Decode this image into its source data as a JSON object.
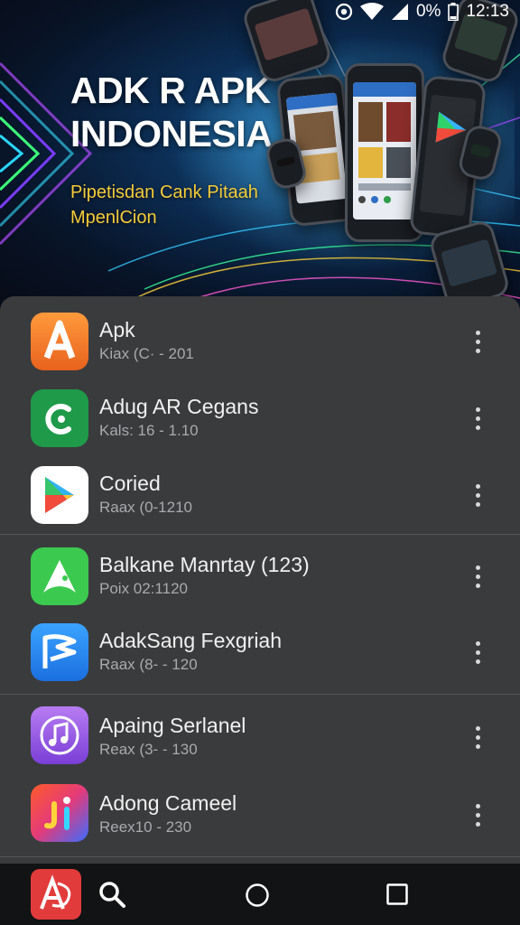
{
  "status_bar": {
    "battery_percent": "0%",
    "time": "12:13",
    "icons": [
      "alarm-icon",
      "wifi-icon",
      "signal-icon",
      "battery-icon"
    ]
  },
  "banner": {
    "title": "ADK R APK INDONESIA",
    "subtitle": "Pipetisdan Cank Pitaah MpenlCion"
  },
  "apps": [
    {
      "name": "Apk",
      "meta": "Kiax (C· - 201",
      "icon": "letter-a-icon"
    },
    {
      "name": "Adug AR Cegans",
      "meta": "Kals: 16 - 1.10",
      "icon": "green-c-icon"
    },
    {
      "name": "Coried",
      "meta": "Raax (0-1210",
      "icon": "play-store-icon"
    },
    {
      "name": "Balkane Manrtay (123)",
      "meta": "Poix 02:1120",
      "icon": "green-triangle-icon"
    },
    {
      "name": "AdakSang Fexgriah",
      "meta": "Raax (8- - 120",
      "icon": "blue-flag-icon"
    },
    {
      "name": "Apaing Serlanel",
      "meta": "Reax (3- - 130",
      "icon": "music-note-icon"
    },
    {
      "name": "Adong Cameel",
      "meta": "Reex10 - 230",
      "icon": "colorful-ji-icon"
    }
  ],
  "colors": {
    "panel_bg": "#3a3b3d",
    "nav_bg": "#121314",
    "subtitle_yellow": "#f4cc3a"
  }
}
